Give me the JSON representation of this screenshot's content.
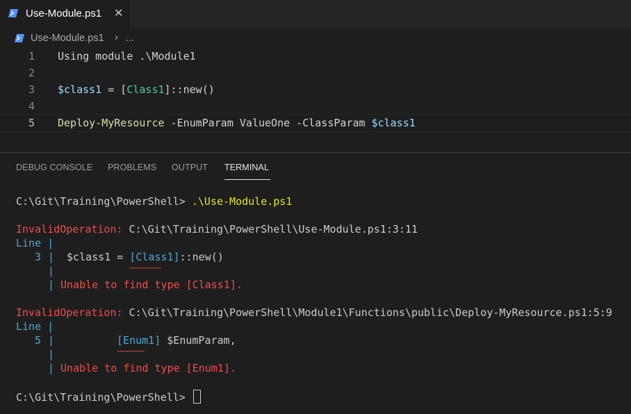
{
  "tab": {
    "label": "Use-Module.ps1",
    "close": "✕"
  },
  "breadcrumb": {
    "file": "Use-Module.ps1",
    "separator": "›",
    "more": "..."
  },
  "editor": {
    "line_numbers": [
      "1",
      "2",
      "3",
      "4",
      "5"
    ],
    "line1": {
      "kw": "Using module",
      "path": " .\\Module1"
    },
    "line3": {
      "var": "$class1",
      "op": " = [",
      "cls": "Class1",
      "tail": "]::new()"
    },
    "line5": {
      "fn": "Deploy-MyResource",
      "p1": " -EnumParam",
      "v1": " ValueOne",
      "p2": " -ClassParam",
      "var": " $class1"
    }
  },
  "panel": {
    "tabs": [
      "DEBUG CONSOLE",
      "PROBLEMS",
      "OUTPUT",
      "TERMINAL"
    ],
    "active_tab": "TERMINAL"
  },
  "terminal": {
    "prompt1": "C:\\Git\\Training\\PowerShell> ",
    "command1": ".\\Use-Module.ps1",
    "err1": {
      "label": "InvalidOperation:",
      "location": " C:\\Git\\Training\\PowerShell\\Use-Module.ps1:3:11",
      "line_label": "Line |",
      "line_no": "3",
      "bar": "|",
      "code_pre": "$class1 = ",
      "code_cls": "[Class1]",
      "code_post": "::new()",
      "squiggle": "~~~~~~~~",
      "message": "Unable to find type [Class1]."
    },
    "err2": {
      "label": "InvalidOperation:",
      "location": " C:\\Git\\Training\\PowerShell\\Module1\\Functions\\public\\Deploy-MyResource.ps1:5:9",
      "line_label": "Line |",
      "line_no": "5",
      "bar": "|",
      "code_cls": "[Enum1]",
      "code_post": " $EnumParam,",
      "squiggle": "~~~~~~~",
      "message": "Unable to find type [Enum1]."
    },
    "prompt2": "C:\\Git\\Training\\PowerShell> "
  }
}
